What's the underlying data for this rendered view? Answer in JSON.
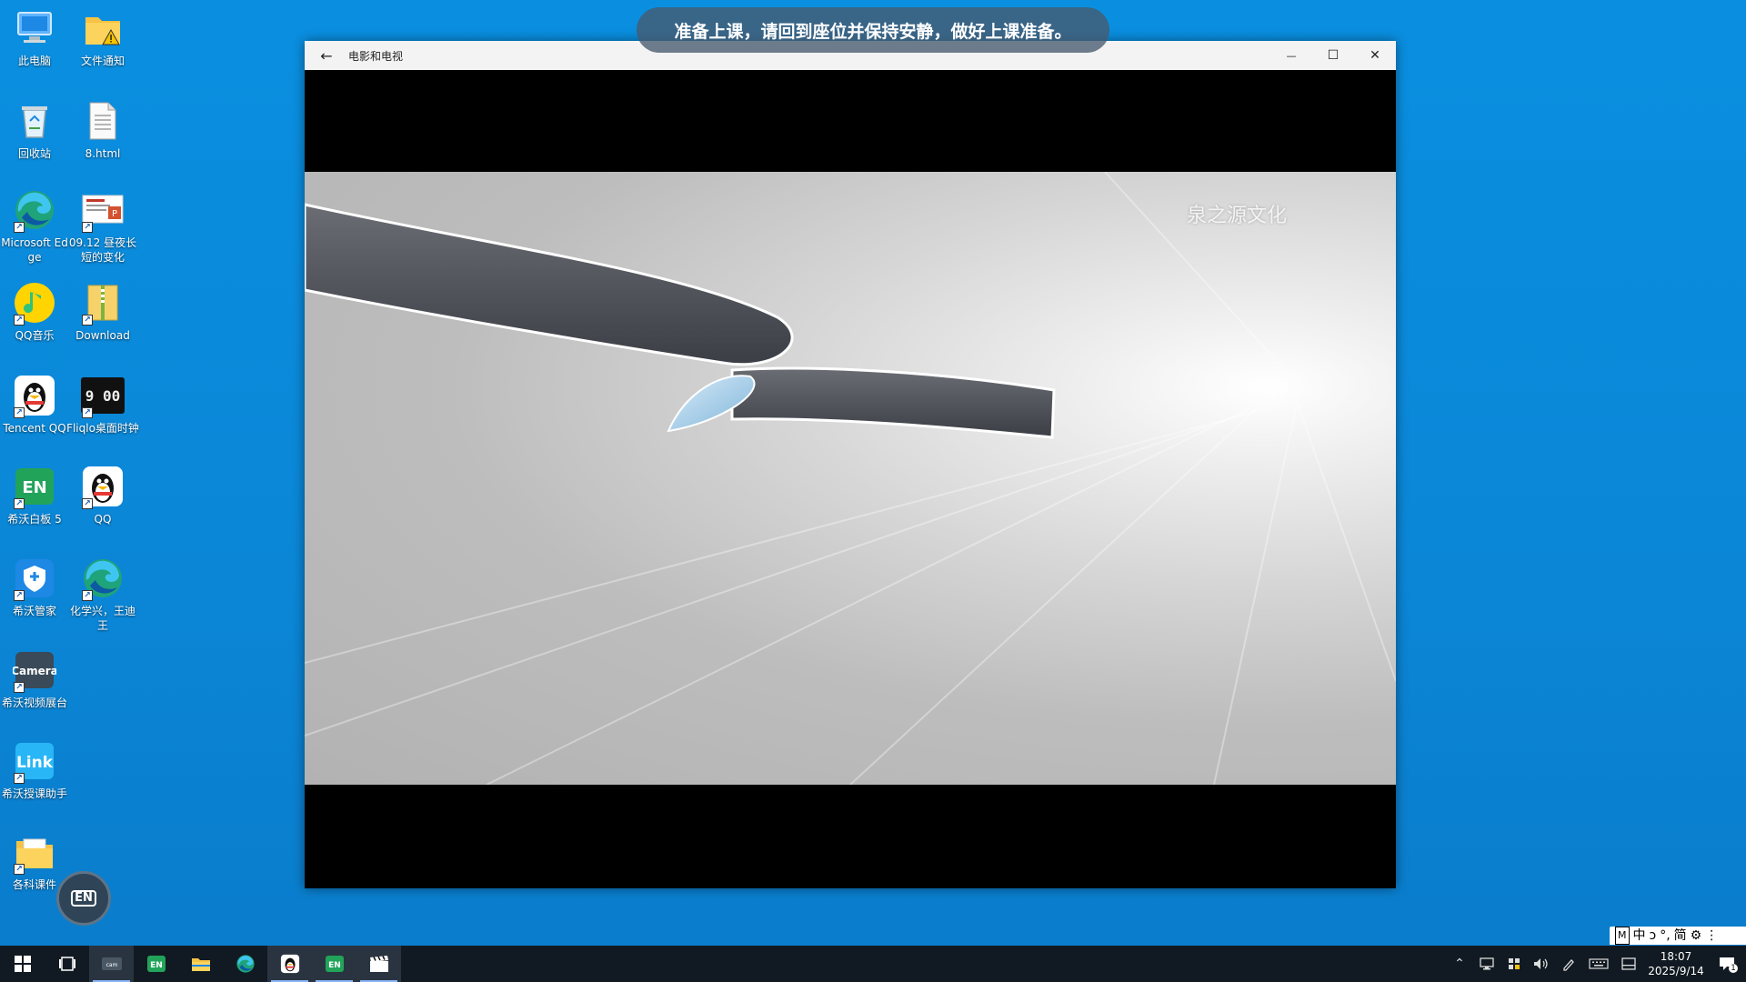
{
  "notice": {
    "text": "准备上课，请回到座位并保持安静，做好上课准备。"
  },
  "desktop_icons": [
    {
      "label": "此电脑"
    },
    {
      "label": "文件通知"
    },
    {
      "label": "回收站"
    },
    {
      "label": "8.html"
    },
    {
      "label": "Microsoft Edge"
    },
    {
      "label": "09.12 昼夜长短的变化"
    },
    {
      "label": "QQ音乐"
    },
    {
      "label": "Download"
    },
    {
      "label": "Tencent QQ"
    },
    {
      "label": "Fliqlo桌面时钟"
    },
    {
      "label": "希沃白板 5"
    },
    {
      "label": "QQ"
    },
    {
      "label": "希沃管家"
    },
    {
      "label": "化学兴，王迪王"
    },
    {
      "label": "希沃视频展台"
    },
    {
      "label": "希沃授课助手"
    },
    {
      "label": "各科课件"
    }
  ],
  "fliqlo_face": "9 00",
  "window": {
    "title": "电影和电视",
    "back_icon": "←",
    "minimize_icon": "—",
    "maximize_icon": "☐",
    "close_icon": "✕",
    "watermark": "泉之源文化"
  },
  "floating_badge": {
    "text": "EN"
  },
  "ime": {
    "items": [
      "M",
      "中",
      "ᴐ",
      "°,",
      "简",
      "⚙",
      "⋮"
    ]
  },
  "taskbar": {
    "apps": [
      "start",
      "task-view",
      "camera-app",
      "easinote",
      "file-explorer",
      "edge",
      "qq",
      "easinote-2",
      "movies-tv"
    ],
    "active_app": "movies-tv"
  },
  "clock": {
    "time": "18:07",
    "date": "2025/9/14"
  },
  "notifications": {
    "count": "1"
  },
  "colors": {
    "desktop": "#0b86d6",
    "taskbar": "#111a22",
    "notice_bg": "#465a6e"
  }
}
